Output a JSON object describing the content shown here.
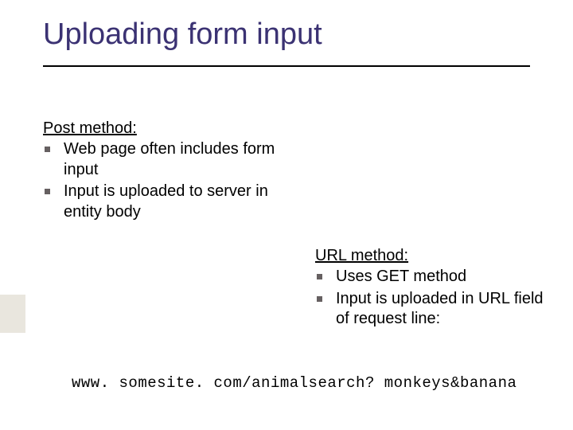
{
  "title": "Uploading form input",
  "post": {
    "heading": "Post method:",
    "items": [
      "Web page often includes form input",
      "Input is uploaded to server in entity body"
    ]
  },
  "url": {
    "heading": "URL method:",
    "items": [
      "Uses GET method",
      "Input is uploaded in URL field of request line:"
    ]
  },
  "example_url": "www. somesite. com/animalsearch? monkeys&banana"
}
